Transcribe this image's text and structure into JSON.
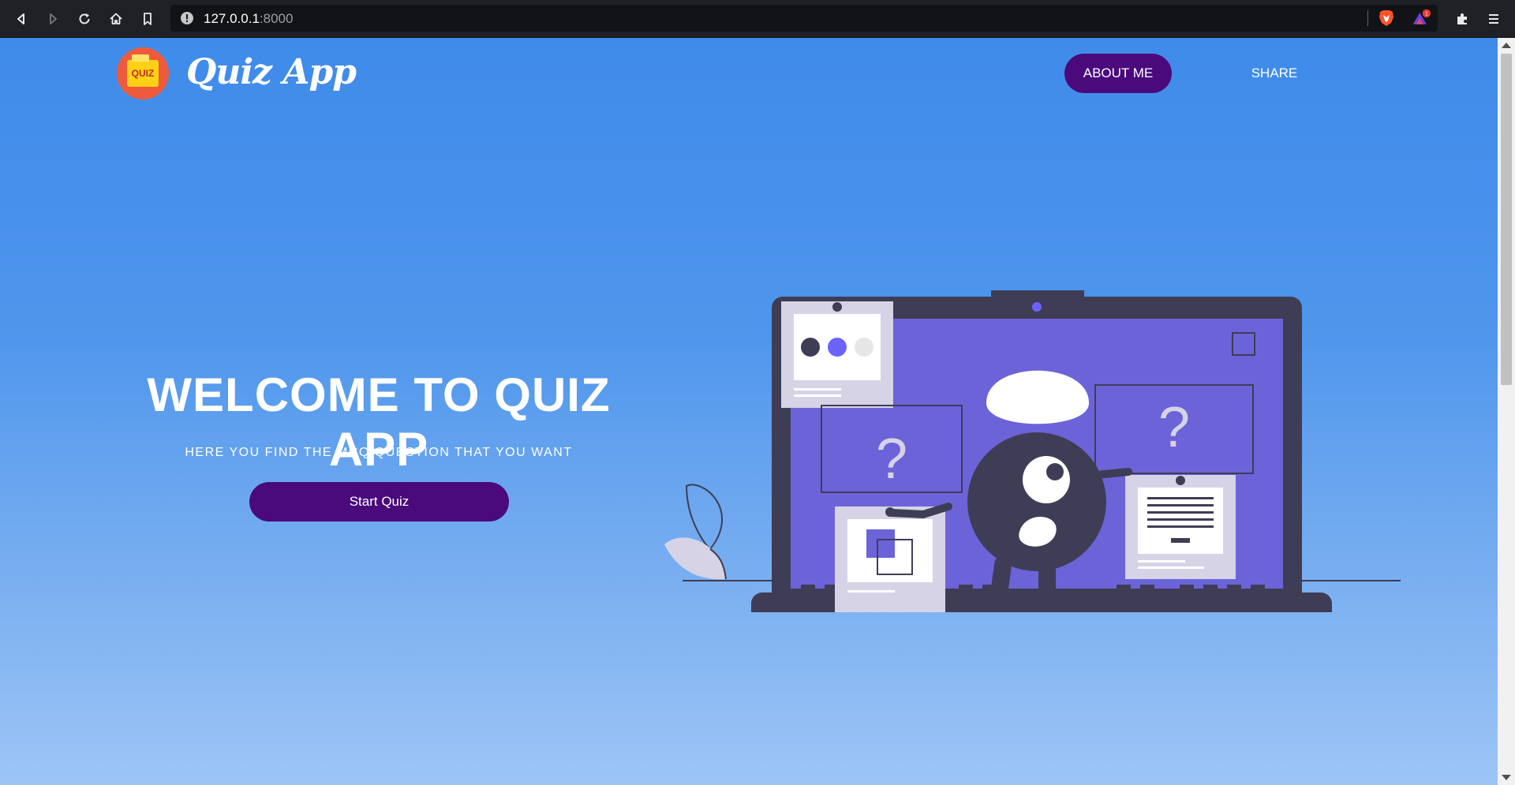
{
  "browser": {
    "url_host": "127.0.0.1",
    "url_port": ":8000",
    "notification_count": "1"
  },
  "header": {
    "logo_badge": "QUIZ",
    "logo_text": "Quiz App",
    "nav": {
      "about_label": "ABOUT ME",
      "share_label": "SHARE"
    }
  },
  "hero": {
    "title": "WELCOME TO QUIZ APP",
    "subtitle": "HERE YOU FIND THE MCQ QUESTION THAT YOU WANT",
    "cta_label": "Start Quiz"
  },
  "illustration": {
    "question_mark_left": "?",
    "question_mark_right": "?",
    "colors": {
      "laptop": "#3f3d56",
      "screen": "#6c63d9",
      "card": "#d6d3e6",
      "accent": "#6c63ff"
    }
  },
  "colors": {
    "page_gradient_top": "#3f8bea",
    "page_gradient_bottom": "#9dc5f6",
    "button_purple": "#4a0a7c"
  }
}
